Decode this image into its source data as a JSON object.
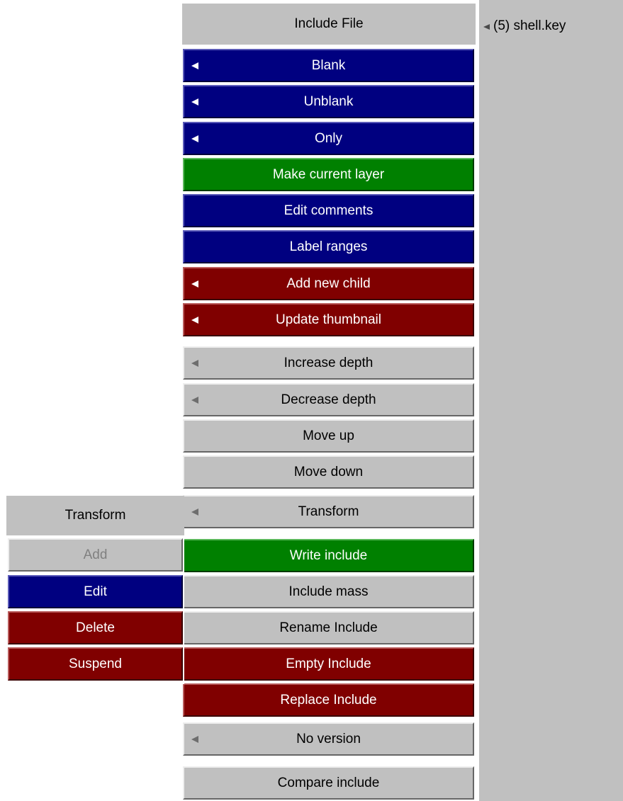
{
  "menu": {
    "header": "Include File",
    "buttons": [
      {
        "label": "Blank",
        "style": "blue",
        "submenu": true
      },
      {
        "label": "Unblank",
        "style": "blue",
        "submenu": true
      },
      {
        "label": "Only",
        "style": "blue",
        "submenu": true
      },
      {
        "label": "Make current layer",
        "style": "green",
        "submenu": false
      },
      {
        "label": "Edit comments",
        "style": "blue",
        "submenu": false
      },
      {
        "label": "Label ranges",
        "style": "blue",
        "submenu": false
      },
      {
        "label": "Add new child",
        "style": "red",
        "submenu": true
      },
      {
        "label": "Update thumbnail",
        "style": "red",
        "submenu": true
      },
      {
        "label": "Increase depth",
        "style": "grey",
        "submenu": true
      },
      {
        "label": "Decrease depth",
        "style": "grey",
        "submenu": true
      },
      {
        "label": "Move up",
        "style": "grey",
        "submenu": false
      },
      {
        "label": "Move down",
        "style": "grey",
        "submenu": false
      },
      {
        "label": "Transform",
        "style": "grey",
        "submenu": true
      },
      {
        "label": "Write include",
        "style": "green",
        "submenu": false
      },
      {
        "label": "Include mass",
        "style": "grey",
        "submenu": false
      },
      {
        "label": "Rename Include",
        "style": "grey",
        "submenu": false
      },
      {
        "label": "Empty Include",
        "style": "red",
        "submenu": false
      },
      {
        "label": "Replace Include",
        "style": "red",
        "submenu": false
      },
      {
        "label": "No version",
        "style": "grey",
        "submenu": true
      },
      {
        "label": "Compare include",
        "style": "grey",
        "submenu": false
      }
    ]
  },
  "transform_panel": {
    "header": "Transform",
    "buttons": [
      {
        "label": "Add",
        "style": "disabled"
      },
      {
        "label": "Edit",
        "style": "blue"
      },
      {
        "label": "Delete",
        "style": "red"
      },
      {
        "label": "Suspend",
        "style": "red"
      }
    ]
  },
  "right_panel": {
    "file_label": "(5) shell.key",
    "icon": "arrow-left-icon"
  },
  "colors": {
    "blue": "#000080",
    "green": "#008000",
    "red": "#800000",
    "grey": "#c0c0c0"
  }
}
